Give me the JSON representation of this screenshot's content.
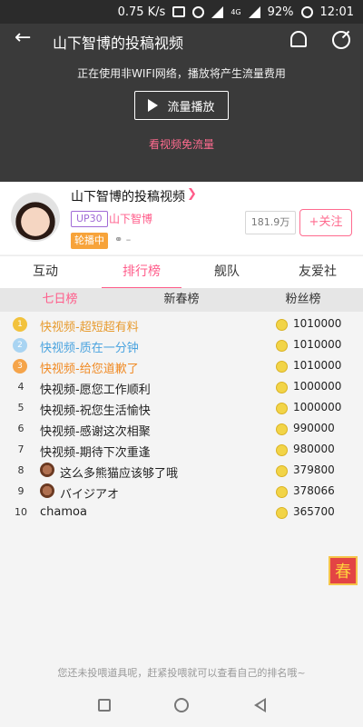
{
  "status_bar": {
    "speed": "0.75 K/s",
    "network": "4G",
    "battery": "92%",
    "time": "12:01"
  },
  "video": {
    "title": "山下智博的投稿视频",
    "notice": "正在使用非WIFI网络，播放将产生流量费用",
    "play_label": "流量播放",
    "free_flow": "看视频免流量"
  },
  "uploader": {
    "title": "山下智博的投稿视频",
    "level_badge": "UP30",
    "name": "山下智博",
    "live_badge": "轮播中",
    "online": "–",
    "fans": "181.9万",
    "follow_label": "+关注"
  },
  "tabs": [
    {
      "label": "互动",
      "active": false
    },
    {
      "label": "排行榜",
      "active": true
    },
    {
      "label": "舰队",
      "active": false
    },
    {
      "label": "友爱社",
      "active": false
    }
  ],
  "subtabs": [
    {
      "label": "七日榜",
      "active": true
    },
    {
      "label": "新春榜",
      "active": false
    },
    {
      "label": "粉丝榜",
      "active": false
    }
  ],
  "ranking": [
    {
      "rank": "1",
      "name": "快视频-超短超有料",
      "score": "1010000",
      "color": "#e79a2d",
      "medal": "#f2c23c"
    },
    {
      "rank": "2",
      "name": "快视频-质在一分钟",
      "score": "1010000",
      "color": "#4aa3df",
      "medal": "#a9d4f2"
    },
    {
      "rank": "3",
      "name": "快视频-给您道歉了",
      "score": "1010000",
      "color": "#f08a24",
      "medal": "#f5a44a"
    },
    {
      "rank": "4",
      "name": "快视频-愿您工作顺利",
      "score": "1000000"
    },
    {
      "rank": "5",
      "name": "快视频-祝您生活愉快",
      "score": "1000000"
    },
    {
      "rank": "6",
      "name": "快视频-感谢这次相聚",
      "score": "990000"
    },
    {
      "rank": "7",
      "name": "快视频-期待下次重逢",
      "score": "980000"
    },
    {
      "rank": "8",
      "name": "这么多熊猫应该够了哦",
      "score": "379800",
      "avatar": true
    },
    {
      "rank": "9",
      "name": "バイジアオ",
      "score": "378066",
      "avatar": true
    },
    {
      "rank": "10",
      "name": "chamoa",
      "score": "365700"
    }
  ],
  "spring_badge": "春",
  "hint": "您还未投喂道具呢，赶紧投喂就可以查看自己的排名哦~"
}
